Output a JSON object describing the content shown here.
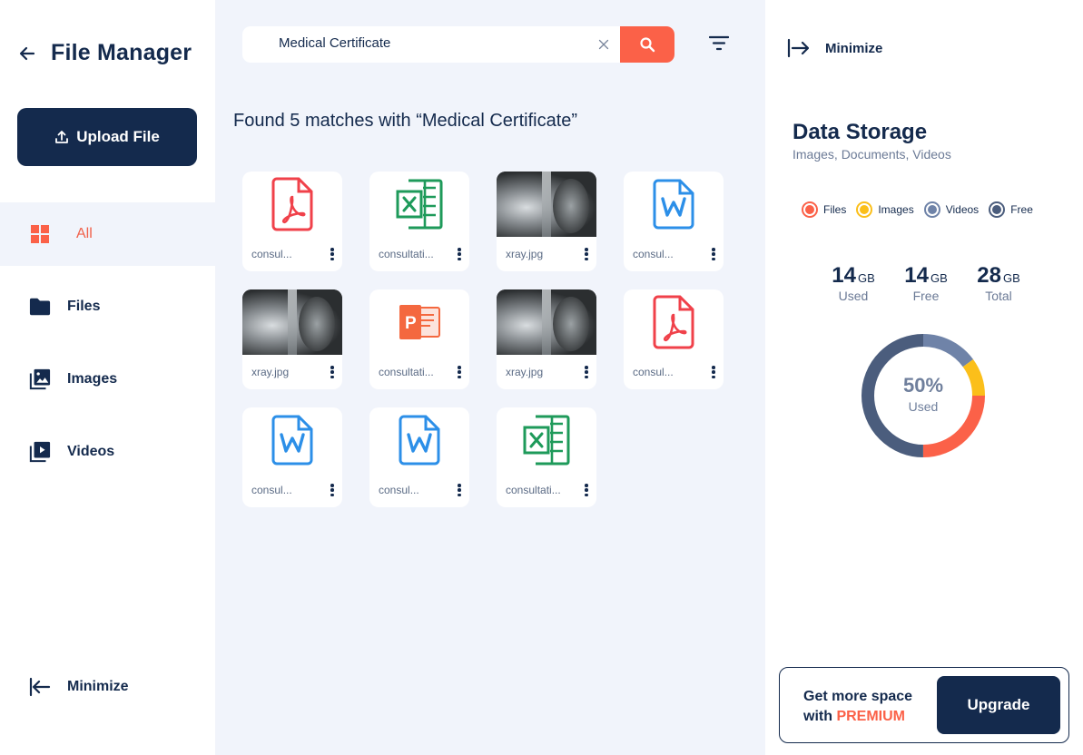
{
  "sidebar": {
    "title": "File Manager",
    "upload_label": "Upload File",
    "items": [
      {
        "label": "All",
        "icon": "grid-icon",
        "active": true
      },
      {
        "label": "Files",
        "icon": "folder-icon",
        "active": false
      },
      {
        "label": "Images",
        "icon": "images-icon",
        "active": false
      },
      {
        "label": "Videos",
        "icon": "video-icon",
        "active": false
      }
    ],
    "minimize_label": "Minimize"
  },
  "search": {
    "value": "Medical Certificate",
    "placeholder": ""
  },
  "results": {
    "found_text": "Found 5 matches with “Medical Certificate”",
    "files": [
      {
        "name": "consul...",
        "type": "pdf"
      },
      {
        "name": "consultati...",
        "type": "excel"
      },
      {
        "name": "xray.jpg",
        "type": "image"
      },
      {
        "name": "consul...",
        "type": "word"
      },
      {
        "name": "xray.jpg",
        "type": "image"
      },
      {
        "name": "consultati...",
        "type": "powerpoint"
      },
      {
        "name": "xray.jpg",
        "type": "image"
      },
      {
        "name": "consul...",
        "type": "pdf"
      },
      {
        "name": "consul...",
        "type": "word"
      },
      {
        "name": "consul...",
        "type": "word"
      },
      {
        "name": "consultati...",
        "type": "excel"
      }
    ]
  },
  "storage": {
    "minimize_label": "Minimize",
    "title": "Data Storage",
    "subtitle": "Images, Documents, Videos",
    "legend": [
      {
        "label": "Files",
        "color": "#fb6148"
      },
      {
        "label": "Images",
        "color": "#fbbf1a"
      },
      {
        "label": "Videos",
        "color": "#6f83a8"
      },
      {
        "label": "Free",
        "color": "#4b5d7d"
      }
    ],
    "stats": [
      {
        "value": "14",
        "unit": "GB",
        "label": "Used"
      },
      {
        "value": "14",
        "unit": "GB",
        "label": "Free"
      },
      {
        "value": "28",
        "unit": "GB",
        "label": "Total"
      }
    ],
    "donut": {
      "percent_text": "50%",
      "label": "Used",
      "segments": [
        {
          "name": "Files",
          "fraction": 0.25,
          "color": "#fb6148"
        },
        {
          "name": "Images",
          "fraction": 0.1,
          "color": "#fbbf1a"
        },
        {
          "name": "Videos",
          "fraction": 0.15,
          "color": "#6f83a8"
        },
        {
          "name": "Free",
          "fraction": 0.5,
          "color": "#4b5d7d"
        }
      ]
    },
    "premium": {
      "line1": "Get more space",
      "line2_prefix": "with",
      "line2_highlight": "PREMIUM",
      "button": "Upgrade"
    }
  }
}
